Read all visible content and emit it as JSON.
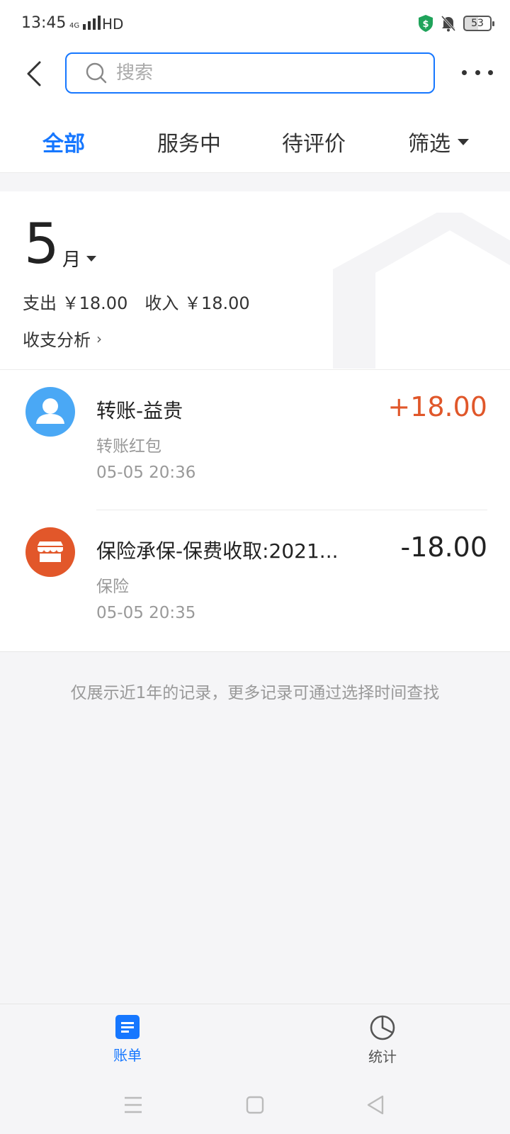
{
  "status_bar": {
    "time": "13:45",
    "network": "4G",
    "hd": "HD",
    "battery": "53"
  },
  "header": {
    "search_placeholder": "搜索"
  },
  "tabs": [
    {
      "label": "全部",
      "active": true
    },
    {
      "label": "服务中",
      "active": false
    },
    {
      "label": "待评价",
      "active": false
    },
    {
      "label": "筛选",
      "active": false
    }
  ],
  "summary": {
    "month_number": "5",
    "month_unit": "月",
    "expense_label": "支出",
    "expense_amount": "￥18.00",
    "income_label": "收入",
    "income_amount": "￥18.00",
    "analysis_link": "收支分析",
    "analysis_chevron": "›"
  },
  "transactions": [
    {
      "title": "转账-益贵",
      "category": "转账红包",
      "time": "05-05  20:36",
      "amount": "+18.00",
      "amount_color": "#e0572a",
      "avatar_color": "#4aa8f5",
      "icon": "person-icon"
    },
    {
      "title": "保险承保-保费收取:2021...",
      "category": "保险",
      "time": "05-05  20:35",
      "amount": "-18.00",
      "amount_color": "#222222",
      "avatar_color": "#e2572a",
      "icon": "shop-icon"
    }
  ],
  "footnote": "仅展示近1年的记录，更多记录可通过选择时间查找",
  "tabbar": [
    {
      "label": "账单",
      "icon": "bill-icon",
      "active": true,
      "color": "#1677ff"
    },
    {
      "label": "统计",
      "icon": "pie-chart-icon",
      "active": false,
      "color": "#555555"
    }
  ]
}
